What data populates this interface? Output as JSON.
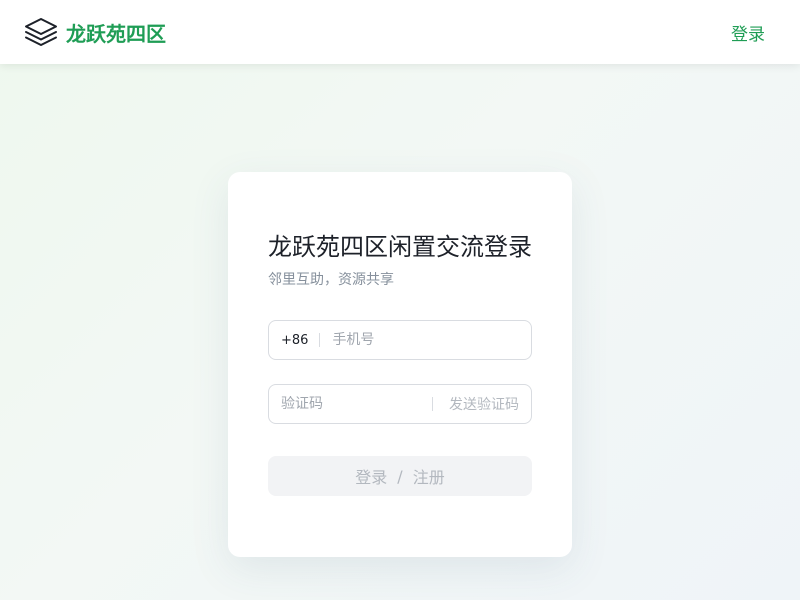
{
  "header": {
    "brand_name": "龙跃苑四区",
    "logo_icon": "layers-icon",
    "login_link": "登录"
  },
  "login_card": {
    "title": "龙跃苑四区闲置交流登录",
    "subtitle": "邻里互助，资源共享",
    "phone": {
      "country_code": "+86",
      "placeholder": "手机号",
      "value": ""
    },
    "code": {
      "placeholder": "验证码",
      "value": "",
      "send_code_label": "发送验证码"
    },
    "submit": {
      "login_label": "登录",
      "separator": "/",
      "register_label": "注册"
    }
  },
  "colors": {
    "brand_green": "#1f9d55",
    "title_text": "#1d2129",
    "muted_text": "#86909c",
    "disabled_button_bg": "#f2f3f5"
  }
}
